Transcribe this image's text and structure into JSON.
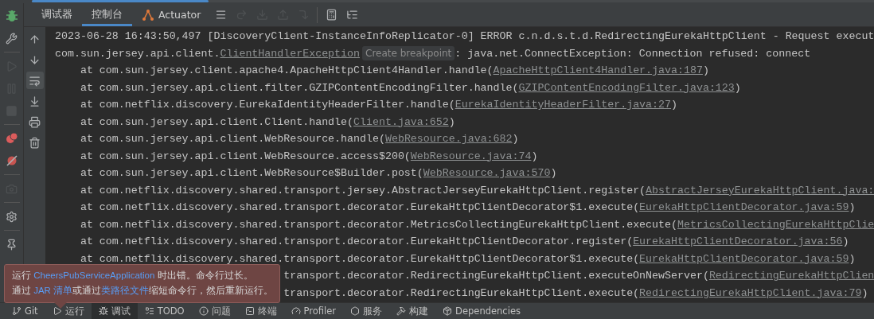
{
  "loading_bar": {
    "level": 0.21
  },
  "debug_tabs": [
    {
      "label": "调试器",
      "selected": false,
      "kind": "plain"
    },
    {
      "label": "控制台",
      "selected": true,
      "kind": "plain"
    },
    {
      "label": "Actuator",
      "selected": false,
      "kind": "actuator"
    }
  ],
  "toolbar": [
    {
      "kind": "menu",
      "disabled": false
    },
    {
      "kind": "step-over",
      "disabled": true
    },
    {
      "kind": "step-into",
      "disabled": true
    },
    {
      "kind": "step-out",
      "disabled": true
    },
    {
      "kind": "run-to-cursor",
      "disabled": true
    },
    {
      "kind": "sep"
    },
    {
      "kind": "calc",
      "disabled": false
    },
    {
      "kind": "trace",
      "disabled": false
    }
  ],
  "side_tools": [
    {
      "kind": "wrench",
      "disabled": false
    },
    {
      "kind": "sep"
    },
    {
      "kind": "resume",
      "disabled": true
    },
    {
      "kind": "pause",
      "disabled": true
    },
    {
      "kind": "stop",
      "disabled": true
    },
    {
      "kind": "sep"
    },
    {
      "kind": "breakpoints",
      "disabled": false
    },
    {
      "kind": "mute",
      "disabled": false
    },
    {
      "kind": "sep"
    },
    {
      "kind": "camera",
      "disabled": true
    },
    {
      "kind": "sep"
    },
    {
      "kind": "settings",
      "disabled": false
    },
    {
      "kind": "sep"
    },
    {
      "kind": "pin",
      "disabled": false
    }
  ],
  "console_tools": [
    {
      "kind": "up",
      "selected": false
    },
    {
      "kind": "down",
      "selected": false
    },
    {
      "kind": "wrap",
      "selected": true
    },
    {
      "kind": "scroll-end",
      "selected": false
    },
    {
      "kind": "print",
      "selected": false
    },
    {
      "kind": "trash",
      "selected": false
    }
  ],
  "console_lines": [
    {
      "kind": "full",
      "segments": [
        {
          "kind": "text",
          "text": "2023-06-28 16:43:50,497 [DiscoveryClient-InstanceInfoReplicator-0] ERROR c.n.d.s.t.d.RedirectingEurekaHttpClient - Request execut"
        }
      ]
    },
    {
      "kind": "full",
      "segments": [
        {
          "kind": "text",
          "text": "com.sun.jersey.api.client."
        },
        {
          "kind": "link",
          "text": "ClientHandlerException"
        },
        {
          "kind": "hint",
          "text": "Create breakpoint"
        },
        {
          "kind": "text",
          "text": ": java.net.ConnectException: Connection refused: connect"
        }
      ]
    },
    {
      "kind": "full",
      "segments": [
        {
          "kind": "text",
          "text": "    at com.sun.jersey.client.apache4.ApacheHttpClient4Handler.handle("
        },
        {
          "kind": "link",
          "text": "ApacheHttpClient4Handler.java:187"
        },
        {
          "kind": "text",
          "text": ")"
        }
      ]
    },
    {
      "kind": "full",
      "segments": [
        {
          "kind": "text",
          "text": "    at com.sun.jersey.api.client.filter.GZIPContentEncodingFilter.handle("
        },
        {
          "kind": "link",
          "text": "GZIPContentEncodingFilter.java:123"
        },
        {
          "kind": "text",
          "text": ")"
        }
      ]
    },
    {
      "kind": "full",
      "segments": [
        {
          "kind": "text",
          "text": "    at com.netflix.discovery.EurekaIdentityHeaderFilter.handle("
        },
        {
          "kind": "link",
          "text": "EurekaIdentityHeaderFilter.java:27"
        },
        {
          "kind": "text",
          "text": ")"
        }
      ]
    },
    {
      "kind": "full",
      "segments": [
        {
          "kind": "text",
          "text": "    at com.sun.jersey.api.client.Client.handle("
        },
        {
          "kind": "link",
          "text": "Client.java:652"
        },
        {
          "kind": "text",
          "text": ")"
        }
      ]
    },
    {
      "kind": "full",
      "segments": [
        {
          "kind": "text",
          "text": "    at com.sun.jersey.api.client.WebResource.handle("
        },
        {
          "kind": "link",
          "text": "WebResource.java:682"
        },
        {
          "kind": "text",
          "text": ")"
        }
      ]
    },
    {
      "kind": "full",
      "segments": [
        {
          "kind": "text",
          "text": "    at com.sun.jersey.api.client.WebResource.access$200("
        },
        {
          "kind": "link",
          "text": "WebResource.java:74"
        },
        {
          "kind": "text",
          "text": ")"
        }
      ]
    },
    {
      "kind": "full",
      "segments": [
        {
          "kind": "text",
          "text": "    at com.sun.jersey.api.client.WebResource$Builder.post("
        },
        {
          "kind": "link",
          "text": "WebResource.java:570"
        },
        {
          "kind": "text",
          "text": ")"
        }
      ]
    },
    {
      "kind": "full",
      "segments": [
        {
          "kind": "text",
          "text": "    at com.netflix.discovery.shared.transport.jersey.AbstractJerseyEurekaHttpClient.register("
        },
        {
          "kind": "link",
          "text": "AbstractJerseyEurekaHttpClient.java:"
        }
      ]
    },
    {
      "kind": "full",
      "segments": [
        {
          "kind": "text",
          "text": "    at com.netflix.discovery.shared.transport.decorator.EurekaHttpClientDecorator$1.execute("
        },
        {
          "kind": "link",
          "text": "EurekaHttpClientDecorator.java:59"
        },
        {
          "kind": "text",
          "text": ")"
        }
      ]
    },
    {
      "kind": "full",
      "segments": [
        {
          "kind": "text",
          "text": "    at com.netflix.discovery.shared.transport.decorator.MetricsCollectingEurekaHttpClient.execute("
        },
        {
          "kind": "link",
          "text": "MetricsCollectingEurekaHttpClie"
        }
      ]
    },
    {
      "kind": "full",
      "segments": [
        {
          "kind": "text",
          "text": "    at com.netflix.discovery.shared.transport.decorator.EurekaHttpClientDecorator.register("
        },
        {
          "kind": "link",
          "text": "EurekaHttpClientDecorator.java:56"
        },
        {
          "kind": "text",
          "text": ")"
        }
      ]
    },
    {
      "kind": "full",
      "segments": [
        {
          "kind": "text",
          "text": "    at com.netflix.discovery.shared.transport.decorator.EurekaHttpClientDecorator$1.execute("
        },
        {
          "kind": "link",
          "text": "EurekaHttpClientDecorator.java:59"
        },
        {
          "kind": "text",
          "text": ")"
        }
      ]
    },
    {
      "kind": "covered",
      "segments": [
        {
          "kind": "text",
          "text": "transport.decorator.RedirectingEurekaHttpClient.executeOnNewServer("
        },
        {
          "kind": "link",
          "text": "RedirectingEurekaHttpClien"
        }
      ]
    },
    {
      "kind": "covered",
      "segments": [
        {
          "kind": "text",
          "text": "transport.decorator.RedirectingEurekaHttpClient.execute("
        },
        {
          "kind": "link",
          "text": "RedirectingEurekaHttpClient.java:79"
        },
        {
          "kind": "text",
          "text": ")"
        }
      ]
    }
  ],
  "error_popup": {
    "lines": [
      [
        {
          "kind": "text",
          "text": "运行 "
        },
        {
          "kind": "link",
          "text": "CheersPubServiceApplication"
        },
        {
          "kind": "text",
          "text": " 时出错。命令行过长。"
        }
      ],
      [
        {
          "kind": "text",
          "text": "通过 "
        },
        {
          "kind": "link",
          "text": "JAR 清单"
        },
        {
          "kind": "text",
          "text": "或通过"
        },
        {
          "kind": "link",
          "text": "类路径文件"
        },
        {
          "kind": "text",
          "text": "缩短命令行，然后重新运行。"
        }
      ]
    ]
  },
  "bottom_tabs": [
    {
      "label": "Git",
      "kind": "git",
      "selected": false
    },
    {
      "label": "运行",
      "kind": "run",
      "selected": false
    },
    {
      "label": "调试",
      "kind": "debug",
      "selected": true
    },
    {
      "label": "TODO",
      "kind": "todo",
      "selected": false
    },
    {
      "label": "问题",
      "kind": "problems",
      "selected": false
    },
    {
      "label": "终端",
      "kind": "terminal",
      "selected": false
    },
    {
      "label": "Profiler",
      "kind": "profiler",
      "selected": false
    },
    {
      "label": "服务",
      "kind": "services",
      "selected": false
    },
    {
      "label": "构建",
      "kind": "build",
      "selected": false
    },
    {
      "label": "Dependencies",
      "kind": "deps",
      "selected": false
    }
  ]
}
